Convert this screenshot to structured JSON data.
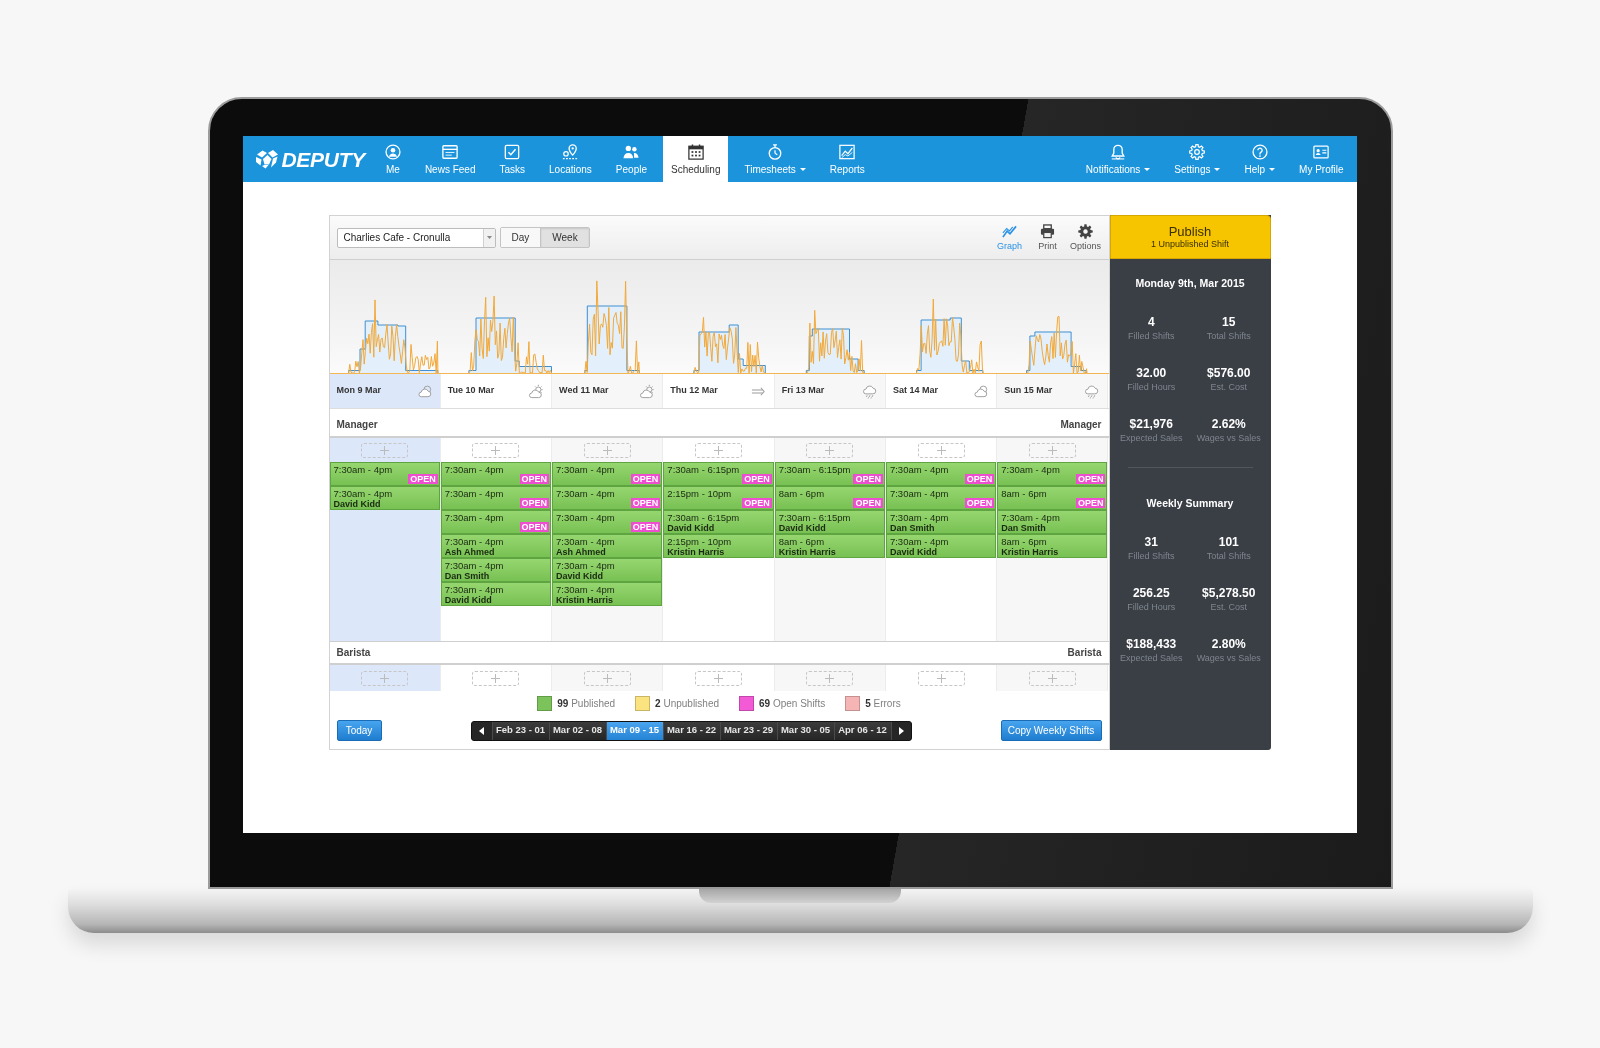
{
  "nav": {
    "logo": "DEPUTY",
    "items": [
      {
        "label": "Me",
        "selected": false,
        "dropdown": false
      },
      {
        "label": "News Feed",
        "selected": false,
        "dropdown": false
      },
      {
        "label": "Tasks",
        "selected": false,
        "dropdown": false
      },
      {
        "label": "Locations",
        "selected": false,
        "dropdown": false
      },
      {
        "label": "People",
        "selected": false,
        "dropdown": false
      },
      {
        "label": "Scheduling",
        "selected": true,
        "dropdown": false
      },
      {
        "label": "Timesheets",
        "selected": false,
        "dropdown": true
      },
      {
        "label": "Reports",
        "selected": false,
        "dropdown": false
      }
    ],
    "right_items": [
      {
        "label": "Notifications",
        "dropdown": true
      },
      {
        "label": "Settings",
        "dropdown": true
      },
      {
        "label": "Help",
        "dropdown": true
      },
      {
        "label": "My Profile",
        "dropdown": false
      }
    ]
  },
  "toolbar": {
    "location": "Charlies Cafe - Cronulla",
    "views": [
      {
        "label": "Day",
        "selected": false
      },
      {
        "label": "Week",
        "selected": true
      }
    ],
    "tools": [
      {
        "label": "Graph",
        "selected": true
      },
      {
        "label": "Print",
        "selected": false
      },
      {
        "label": "Options",
        "selected": false
      }
    ]
  },
  "days": [
    {
      "label": "Mon 9 Mar",
      "selected": true,
      "kind": "cloudy"
    },
    {
      "label": "Tue 10 Mar",
      "selected": false,
      "kind": "sunny"
    },
    {
      "label": "Wed 11 Mar",
      "selected": false,
      "kind": "sunny"
    },
    {
      "label": "Thu 12 Mar",
      "selected": false,
      "kind": "windy"
    },
    {
      "label": "Fri 13 Mar",
      "selected": false,
      "kind": "rainy"
    },
    {
      "label": "Sat 14 Mar",
      "selected": false,
      "kind": "cloudy"
    },
    {
      "label": "Sun 15 Mar",
      "selected": false,
      "kind": "rainy"
    }
  ],
  "sections": [
    {
      "title": "Manager",
      "title_right": "Manager",
      "shifts": [
        [
          {
            "time": "7:30am - 4pm",
            "badge": "OPEN"
          },
          {
            "time": "7:30am - 4pm",
            "employee": "David Kidd"
          }
        ],
        [
          {
            "time": "7:30am - 4pm",
            "badge": "OPEN"
          },
          {
            "time": "7:30am - 4pm",
            "badge": "OPEN"
          },
          {
            "time": "7:30am - 4pm",
            "badge": "OPEN"
          },
          {
            "time": "7:30am - 4pm",
            "employee": "Ash Ahmed"
          },
          {
            "time": "7:30am - 4pm",
            "employee": "Dan Smith"
          },
          {
            "time": "7:30am - 4pm",
            "employee": "David Kidd"
          }
        ],
        [
          {
            "time": "7:30am - 4pm",
            "badge": "OPEN"
          },
          {
            "time": "7:30am - 4pm",
            "badge": "OPEN"
          },
          {
            "time": "7:30am - 4pm",
            "badge": "OPEN"
          },
          {
            "time": "7:30am - 4pm",
            "employee": "Ash Ahmed"
          },
          {
            "time": "7:30am - 4pm",
            "employee": "David Kidd"
          },
          {
            "time": "7:30am - 4pm",
            "employee": "Kristin Harris"
          }
        ],
        [
          {
            "time": "7:30am - 6:15pm",
            "badge": "OPEN"
          },
          {
            "time": "2:15pm - 10pm",
            "badge": "OPEN"
          },
          {
            "time": "7:30am - 6:15pm",
            "employee": "David Kidd"
          },
          {
            "time": "2:15pm - 10pm",
            "employee": "Kristin Harris"
          }
        ],
        [
          {
            "time": "7:30am - 6:15pm",
            "badge": "OPEN"
          },
          {
            "time": "8am - 6pm",
            "badge": "OPEN"
          },
          {
            "time": "7:30am - 6:15pm",
            "employee": "David Kidd"
          },
          {
            "time": "8am - 6pm",
            "employee": "Kristin Harris"
          }
        ],
        [
          {
            "time": "7:30am - 4pm",
            "badge": "OPEN"
          },
          {
            "time": "7:30am - 4pm",
            "badge": "OPEN"
          },
          {
            "time": "7:30am - 4pm",
            "employee": "Dan Smith"
          },
          {
            "time": "7:30am - 4pm",
            "employee": "David Kidd"
          }
        ],
        [
          {
            "time": "7:30am - 4pm",
            "badge": "OPEN"
          },
          {
            "time": "8am - 6pm",
            "badge": "OPEN"
          },
          {
            "time": "7:30am - 4pm",
            "employee": "Dan Smith"
          },
          {
            "time": "8am - 6pm",
            "employee": "Kristin Harris"
          }
        ]
      ]
    },
    {
      "title": "Barista",
      "title_right": "Barista"
    }
  ],
  "legend": [
    {
      "text": "**99** Published",
      "color": "#7cc35b"
    },
    {
      "text": "**2** Unpublished",
      "color": "#fbe37f"
    },
    {
      "text": "**69** Open Shifts",
      "color": "#f25ad6"
    },
    {
      "text": "**5** Errors",
      "color": "#f5b5b5"
    }
  ],
  "footer": {
    "today": "Today",
    "weeks": [
      {
        "label": "Feb 23 - 01",
        "selected": false
      },
      {
        "label": "Mar 02 - 08",
        "selected": false
      },
      {
        "label": "Mar 09 - 15",
        "selected": true
      },
      {
        "label": "Mar 16 - 22",
        "selected": false
      },
      {
        "label": "Mar 23 - 29",
        "selected": false
      },
      {
        "label": "Mar 30 - 05",
        "selected": false
      },
      {
        "label": "Apr 06 - 12",
        "selected": false
      }
    ],
    "copy": "Copy Weekly Shifts"
  },
  "summary": {
    "publish": {
      "title": "Publish",
      "subtitle": "1 Unpublished Shift"
    },
    "blocks": [
      {
        "title": "Monday 9th, Mar 2015",
        "stats": [
          {
            "value": "4",
            "label": "Filled Shifts"
          },
          {
            "value": "15",
            "label": "Total Shifts"
          },
          {
            "value": "32.00",
            "label": "Filled Hours"
          },
          {
            "value": "$576.00",
            "label": "Est. Cost"
          },
          {
            "value": "$21,976",
            "label": "Expected Sales"
          },
          {
            "value": "2.62%",
            "label": "Wages vs Sales"
          }
        ]
      },
      {
        "title": "Weekly Summary",
        "stats": [
          {
            "value": "31",
            "label": "Filled Shifts"
          },
          {
            "value": "101",
            "label": "Total Shifts"
          },
          {
            "value": "256.25",
            "label": "Filled Hours"
          },
          {
            "value": "$5,278.50",
            "label": "Est. Cost"
          },
          {
            "value": "$188,433",
            "label": "Expected Sales"
          },
          {
            "value": "2.80%",
            "label": "Wages vs Sales"
          }
        ]
      }
    ]
  }
}
